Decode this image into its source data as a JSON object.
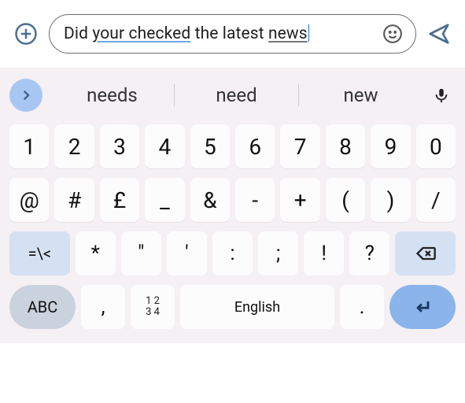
{
  "composer": {
    "prefix": "Did ",
    "grammar_span": "your checked",
    "middle": " the latest ",
    "underline_span": "news"
  },
  "suggestions": {
    "items": [
      "needs",
      "need",
      "new"
    ]
  },
  "keyboard": {
    "row1": [
      "1",
      "2",
      "3",
      "4",
      "5",
      "6",
      "7",
      "8",
      "9",
      "0"
    ],
    "row2": [
      "@",
      "#",
      "£",
      "_",
      "&",
      "-",
      "+",
      "(",
      ")",
      "/"
    ],
    "row3_shift": "=\\<",
    "row3": [
      "*",
      "\"",
      "'",
      ":",
      ";",
      "!",
      "?"
    ],
    "row4_mode": "ABC",
    "row4_comma": ",",
    "row4_numlock_top": "1 2",
    "row4_numlock_bot": "3 4",
    "row4_space": "English",
    "row4_period": "."
  }
}
